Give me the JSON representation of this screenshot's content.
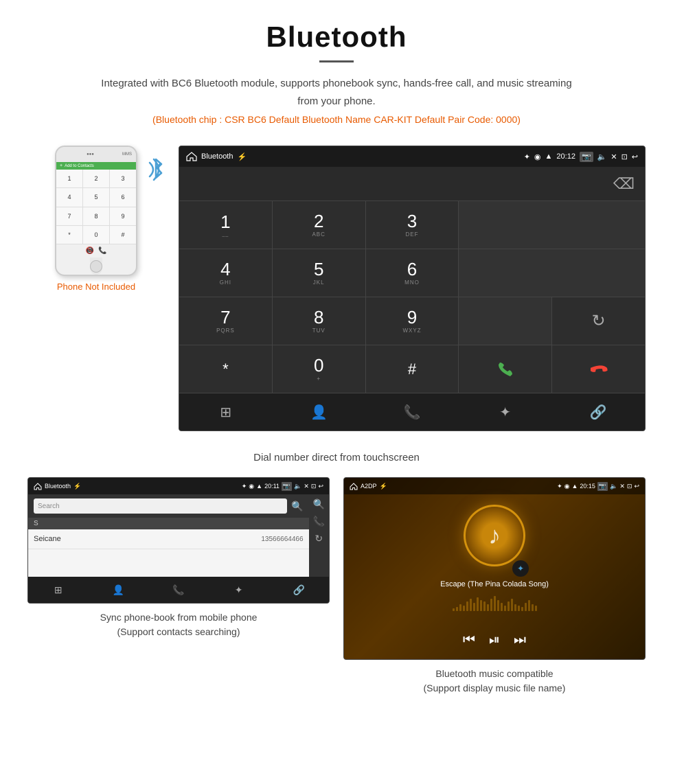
{
  "page": {
    "title": "Bluetooth",
    "description": "Integrated with BC6 Bluetooth module, supports phonebook sync, hands-free call, and music streaming from your phone.",
    "specs": "(Bluetooth chip : CSR BC6    Default Bluetooth Name CAR-KIT    Default Pair Code: 0000)"
  },
  "car_screen": {
    "title": "Bluetooth",
    "time": "20:12",
    "dial_keys": [
      {
        "main": "1",
        "sub": ""
      },
      {
        "main": "2",
        "sub": "ABC"
      },
      {
        "main": "3",
        "sub": "DEF"
      },
      {
        "main": "",
        "sub": ""
      },
      {
        "main": "⌫",
        "sub": ""
      },
      {
        "main": "4",
        "sub": "GHI"
      },
      {
        "main": "5",
        "sub": "JKL"
      },
      {
        "main": "6",
        "sub": "MNO"
      },
      {
        "main": "",
        "sub": ""
      },
      {
        "main": "",
        "sub": ""
      },
      {
        "main": "7",
        "sub": "PQRS"
      },
      {
        "main": "8",
        "sub": "TUV"
      },
      {
        "main": "9",
        "sub": "WXYZ"
      },
      {
        "main": "",
        "sub": ""
      },
      {
        "main": "↻",
        "sub": ""
      },
      {
        "main": "*",
        "sub": ""
      },
      {
        "main": "0",
        "sub": "+"
      },
      {
        "main": "#",
        "sub": ""
      },
      {
        "main": "📞",
        "sub": ""
      },
      {
        "main": "📵",
        "sub": ""
      }
    ]
  },
  "dial_caption": "Dial number direct from touchscreen",
  "phonebook": {
    "title": "Bluetooth",
    "time": "20:11",
    "search_placeholder": "Search",
    "section_letter": "S",
    "contact_name": "Seicane",
    "contact_number": "13566664466"
  },
  "music": {
    "title": "A2DP",
    "time": "20:15",
    "song_title": "Escape (The Pina Colada Song)"
  },
  "phone": {
    "not_included_label": "Phone Not Included"
  },
  "captions": {
    "phonebook": "Sync phone-book from mobile phone\n(Support contacts searching)",
    "music": "Bluetooth music compatible\n(Support display music file name)"
  },
  "viz_heights": [
    4,
    6,
    10,
    8,
    14,
    18,
    12,
    20,
    16,
    14,
    10,
    18,
    22,
    16,
    12,
    8,
    14,
    18,
    10,
    8,
    6,
    12,
    16,
    10,
    8
  ]
}
